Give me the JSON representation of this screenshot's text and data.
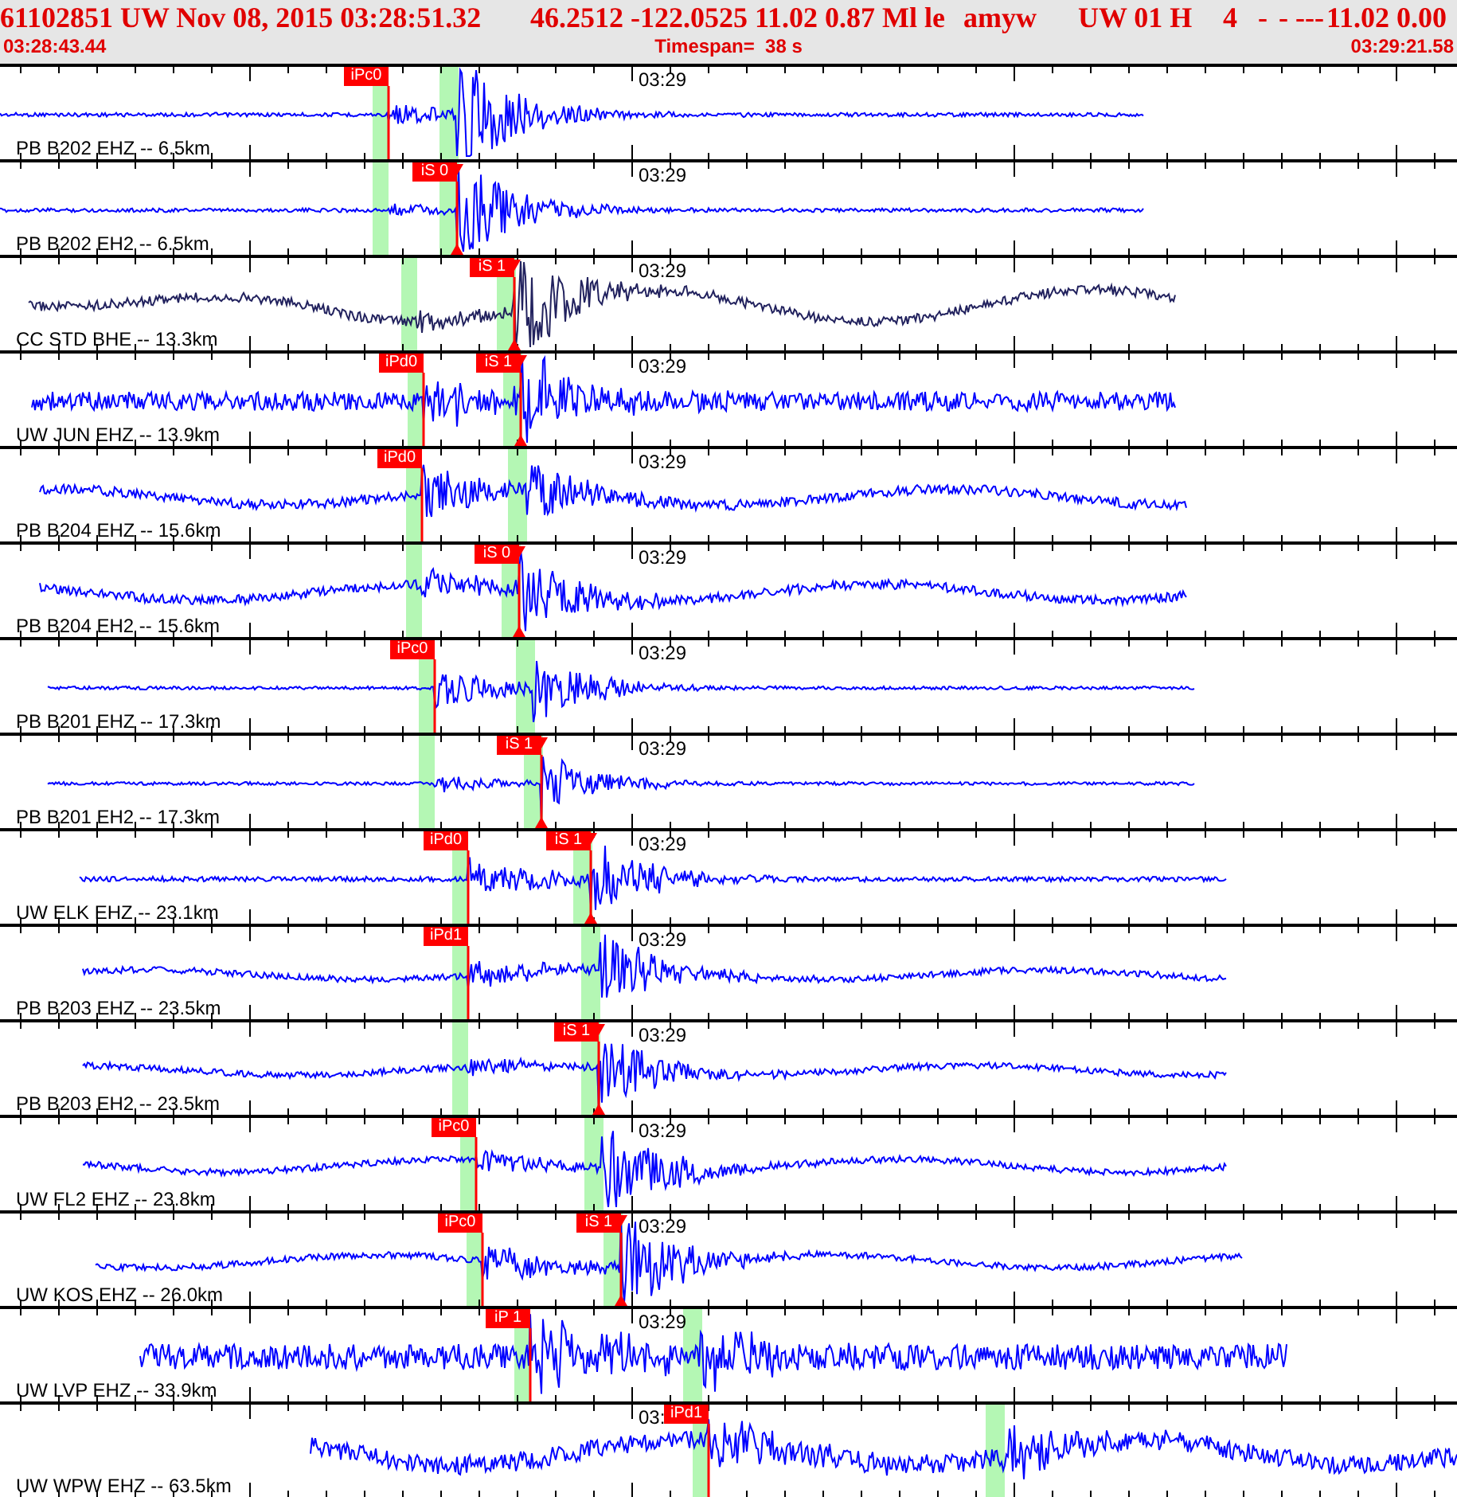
{
  "header": {
    "segments": [
      "61102851 UW Nov 08, 2015 03:28:51.32",
      "46.2512 -122.0525 11.02 0.87 Ml le",
      "amyw",
      "UW 01 H",
      "4",
      "-",
      "- ---",
      "11.02 0.00"
    ],
    "start_time": "03:28:43.44",
    "timespan": "Timespan=  38 s",
    "end_time": "03:29:21.58"
  },
  "traces": [
    {
      "label": "PB B202 EHZ -- 6.5km",
      "time_mark": "03:29",
      "picks": [
        {
          "label": "iPc0",
          "kind": "P"
        }
      ]
    },
    {
      "label": "PB B202 EH2 -- 6.5km",
      "time_mark": "03:29",
      "picks": [
        {
          "label": "iS 0",
          "kind": "S"
        }
      ]
    },
    {
      "label": "CC STD BHE -- 13.3km",
      "time_mark": "03:29",
      "picks": [
        {
          "label": "iS 1",
          "kind": "S"
        }
      ]
    },
    {
      "label": "UW JUN EHZ -- 13.9km",
      "time_mark": "03:29",
      "picks": [
        {
          "label": "iPd0",
          "kind": "P"
        },
        {
          "label": "iS 1",
          "kind": "S"
        }
      ]
    },
    {
      "label": "PB B204 EHZ -- 15.6km",
      "time_mark": "03:29",
      "picks": [
        {
          "label": "iPd0",
          "kind": "P"
        }
      ]
    },
    {
      "label": "PB B204 EH2 -- 15.6km",
      "time_mark": "03:29",
      "picks": [
        {
          "label": "iS 0",
          "kind": "S"
        }
      ]
    },
    {
      "label": "PB B201 EHZ -- 17.3km",
      "time_mark": "03:29",
      "picks": [
        {
          "label": "iPc0",
          "kind": "P"
        }
      ]
    },
    {
      "label": "PB B201 EH2 -- 17.3km",
      "time_mark": "03:29",
      "picks": [
        {
          "label": "iS 1",
          "kind": "S"
        }
      ]
    },
    {
      "label": "UW ELK EHZ -- 23.1km",
      "time_mark": "03:29",
      "picks": [
        {
          "label": "iPd0",
          "kind": "P"
        },
        {
          "label": "iS 1",
          "kind": "S"
        }
      ]
    },
    {
      "label": "PB B203 EHZ -- 23.5km",
      "time_mark": "03:29",
      "picks": [
        {
          "label": "iPd1",
          "kind": "P"
        }
      ]
    },
    {
      "label": "PB B203 EH2 -- 23.5km",
      "time_mark": "03:29",
      "picks": [
        {
          "label": "iS 1",
          "kind": "S"
        }
      ]
    },
    {
      "label": "UW FL2 EHZ -- 23.8km",
      "time_mark": "03:29",
      "picks": [
        {
          "label": "iPc0",
          "kind": "P"
        }
      ]
    },
    {
      "label": "UW KOS EHZ -- 26.0km",
      "time_mark": "03:29",
      "picks": [
        {
          "label": "iPc0",
          "kind": "P"
        },
        {
          "label": "iS 1",
          "kind": "S"
        }
      ]
    },
    {
      "label": "UW LVP EHZ -- 33.9km",
      "time_mark": "03:29",
      "picks": [
        {
          "label": "iP 1",
          "kind": "P"
        }
      ]
    },
    {
      "label": "UW WPW EHZ -- 63.5km",
      "time_mark": "03:",
      "picks": [
        {
          "label": "iPd1",
          "kind": "P"
        }
      ]
    }
  ]
}
